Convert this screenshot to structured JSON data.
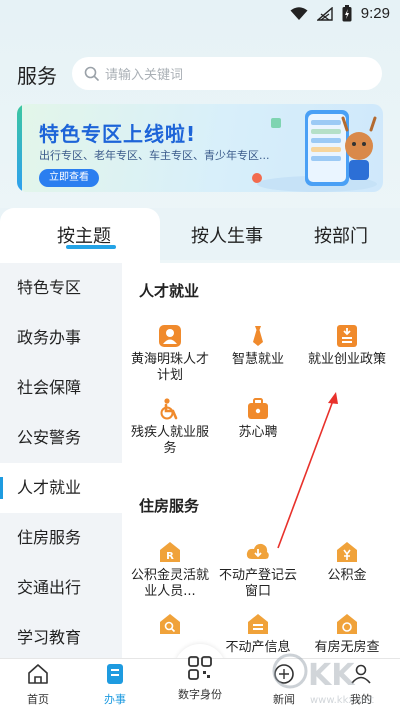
{
  "status": {
    "time": "9:29"
  },
  "header": {
    "title": "服务",
    "search_placeholder": "请输入关键词"
  },
  "banner": {
    "title": "特色专区上线啦!",
    "subtitle": "出行专区、老年专区、车主专区、青少年专区...",
    "button": "立即查看"
  },
  "tabs": [
    {
      "label": "按主题",
      "active": true
    },
    {
      "label": "按人生事",
      "active": false
    },
    {
      "label": "按部门",
      "active": false
    }
  ],
  "sidebar": {
    "items": [
      {
        "label": "特色专区"
      },
      {
        "label": "政务办事"
      },
      {
        "label": "社会保障"
      },
      {
        "label": "公安警务"
      },
      {
        "label": "人才就业"
      },
      {
        "label": "住房服务"
      },
      {
        "label": "交通出行"
      },
      {
        "label": "学习教育"
      }
    ],
    "active_label": "人才就业"
  },
  "sections": [
    {
      "title": "人才就业",
      "items": [
        {
          "label": "黄海明珠人才计划",
          "icon": "person-icon"
        },
        {
          "label": "智慧就业",
          "icon": "tie-icon"
        },
        {
          "label": "就业创业政策",
          "icon": "document-icon"
        },
        {
          "label": "残疾人就业服务",
          "icon": "wheelchair-icon"
        },
        {
          "label": "苏心聘",
          "icon": "briefcase-icon"
        }
      ]
    },
    {
      "title": "住房服务",
      "items": [
        {
          "label": "公积金灵活就业人员...",
          "icon": "housing-fund-icon"
        },
        {
          "label": "不动产登记云窗口",
          "icon": "cloud-download-icon"
        },
        {
          "label": "公积金",
          "icon": "yuan-house-icon"
        },
        {
          "label": "",
          "icon": "house-search-icon"
        },
        {
          "label": "不动产信息",
          "icon": "property-info-icon"
        },
        {
          "label": "有房无房查",
          "icon": "house-query-icon"
        }
      ]
    }
  ],
  "bottom_nav": [
    {
      "label": "首页",
      "icon": "home-icon",
      "active": false
    },
    {
      "label": "办事",
      "icon": "service-icon",
      "active": true
    },
    {
      "label": "数字身份",
      "icon": "qr-code-icon",
      "active": false
    },
    {
      "label": "新闻",
      "icon": "news-icon",
      "active": false
    },
    {
      "label": "我的",
      "icon": "profile-icon",
      "active": false
    }
  ],
  "colors": {
    "accent": "#1e9be0",
    "icon_orange": "#f08a2c",
    "banner_title": "#1d64d8"
  }
}
